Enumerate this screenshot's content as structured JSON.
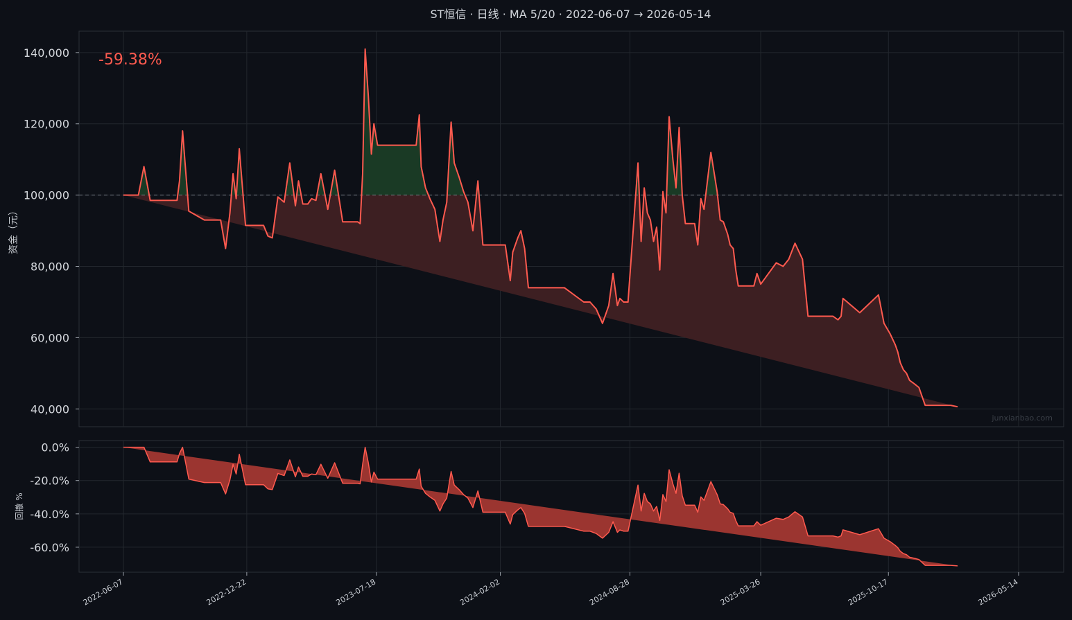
{
  "chart_data": [
    {
      "type": "area",
      "panel": "equity",
      "title": "ST恒信 · 日线 · MA 5/20 · 2022-06-07 → 2026-05-14",
      "ylabel": "资金（元）",
      "xlabel": "",
      "annotation": "-59.38%",
      "watermark": "junxianbao.com",
      "baseline": 100000,
      "ylim": [
        35000,
        146000
      ],
      "yticks": [
        40000,
        60000,
        80000,
        100000,
        120000,
        140000
      ],
      "ytick_labels": [
        "40,000",
        "60,000",
        "80,000",
        "100,000",
        "120,000",
        "140,000"
      ],
      "xticks": [
        "2022-06-07",
        "2022-12-22",
        "2023-07-18",
        "2024-02-02",
        "2024-08-28",
        "2025-03-26",
        "2025-10-17",
        "2026-05-14"
      ],
      "grid": true,
      "colors": {
        "line": "#ff5a4f",
        "gain_fill": "#1a3a25",
        "loss_fill": "#3d1f22",
        "baseline": "#7a8088"
      },
      "x": [
        "2022-06-07",
        "2022-07-01",
        "2022-07-10",
        "2022-07-20",
        "2022-08-01",
        "2022-08-20",
        "2022-09-01",
        "2022-09-05",
        "2022-09-10",
        "2022-09-14",
        "2022-09-20",
        "2022-10-15",
        "2022-10-25",
        "2022-10-28",
        "2022-11-05",
        "2022-11-10",
        "2022-11-18",
        "2022-11-25",
        "2022-11-30",
        "2022-12-05",
        "2022-12-10",
        "2022-12-20",
        "2022-12-28",
        "2023-01-01",
        "2023-01-05",
        "2023-01-12",
        "2023-01-18",
        "2023-01-25",
        "2023-02-01",
        "2023-02-10",
        "2023-02-20",
        "2023-03-01",
        "2023-03-10",
        "2023-03-15",
        "2023-03-22",
        "2023-03-30",
        "2023-04-05",
        "2023-04-12",
        "2023-04-20",
        "2023-05-01",
        "2023-05-12",
        "2023-05-25",
        "2023-06-05",
        "2023-06-10",
        "2023-06-14",
        "2023-06-18",
        "2023-06-22",
        "2023-06-26",
        "2023-06-30",
        "2023-07-05",
        "2023-07-10",
        "2023-07-14",
        "2023-07-20",
        "2023-08-10",
        "2023-09-01",
        "2023-09-20",
        "2023-09-25",
        "2023-09-28",
        "2023-10-05",
        "2023-10-12",
        "2023-10-20",
        "2023-10-28",
        "2023-11-02",
        "2023-11-08",
        "2023-11-15",
        "2023-11-20",
        "2023-11-28",
        "2023-12-05",
        "2023-12-12",
        "2023-12-20",
        "2023-12-28",
        "2024-01-05",
        "2024-01-10",
        "2024-01-25",
        "2024-02-10",
        "2024-02-18",
        "2024-02-22",
        "2024-03-01",
        "2024-03-06",
        "2024-03-12",
        "2024-03-18",
        "2024-03-25",
        "2024-04-01",
        "2024-04-15",
        "2024-05-15",
        "2024-06-15",
        "2024-06-20",
        "2024-06-25",
        "2024-07-05",
        "2024-07-15",
        "2024-07-25",
        "2024-08-01",
        "2024-08-08",
        "2024-08-12",
        "2024-08-18",
        "2024-08-25",
        "2024-09-01",
        "2024-09-10",
        "2024-09-15",
        "2024-09-20",
        "2024-09-25",
        "2024-09-30",
        "2024-10-05",
        "2024-10-10",
        "2024-10-15",
        "2024-10-20",
        "2024-10-25",
        "2024-10-30",
        "2024-11-05",
        "2024-11-10",
        "2024-11-15",
        "2024-11-20",
        "2024-11-25",
        "2024-11-28",
        "2024-12-01",
        "2024-12-05",
        "2024-12-10",
        "2024-12-15",
        "2024-12-20",
        "2024-12-25",
        "2025-01-05",
        "2025-01-15",
        "2025-01-20",
        "2025-01-25",
        "2025-02-01",
        "2025-02-05",
        "2025-02-10",
        "2025-02-14",
        "2025-02-18",
        "2025-02-22",
        "2025-03-01",
        "2025-03-05",
        "2025-03-10",
        "2025-03-15",
        "2025-03-20",
        "2025-03-26",
        "2025-04-20",
        "2025-05-01",
        "2025-05-10",
        "2025-05-20",
        "2025-06-01",
        "2025-06-10",
        "2025-06-20",
        "2025-07-01",
        "2025-07-10",
        "2025-07-20",
        "2025-07-28",
        "2025-08-02",
        "2025-08-05",
        "2025-09-01",
        "2025-10-01",
        "2025-10-10",
        "2025-10-20",
        "2025-10-28",
        "2025-11-01",
        "2025-11-05",
        "2025-11-10",
        "2025-11-15",
        "2025-11-20",
        "2025-11-28",
        "2025-12-05",
        "2025-12-15",
        "2025-12-25",
        "2026-01-05",
        "2026-01-15",
        "2026-01-25",
        "2026-02-05",
        "2026-02-20",
        "2026-03-05",
        "2026-04-01",
        "2026-04-20",
        "2026-05-01",
        "2026-05-08",
        "2026-05-14"
      ],
      "series": [
        {
          "values": [
            100000,
            100000,
            108000,
            98500,
            98500,
            98500,
            98500,
            104000,
            118000,
            109000,
            95500,
            93000,
            93000,
            93000,
            93000,
            93000,
            85000,
            95000,
            106000,
            99000,
            113000,
            91500,
            91500,
            91500,
            91500,
            91500,
            91500,
            88500,
            88000,
            99500,
            98000,
            109000,
            97000,
            104000,
            97500,
            97500,
            99000,
            98500,
            106000,
            96000,
            107000,
            92500,
            92500,
            92500,
            92500,
            92500,
            92000,
            106000,
            141000,
            128000,
            111500,
            120000,
            114000,
            114000,
            114000,
            114000,
            122500,
            108000,
            102000,
            99000,
            96000,
            87000,
            93000,
            98000,
            120500,
            109000,
            105000,
            101000,
            98000,
            90000,
            104000,
            86000,
            86000,
            86000,
            86000,
            76000,
            84000,
            88000,
            90000,
            85000,
            74000,
            74000,
            74000,
            74000,
            74000,
            70000,
            70000,
            70000,
            68000,
            64000,
            69000,
            78000,
            69000,
            71000,
            70000,
            70000,
            87000,
            109000,
            87000,
            102000,
            95000,
            93000,
            87000,
            91000,
            79000,
            101000,
            95000,
            122000,
            110000,
            102000,
            119000,
            100000,
            92000,
            92000,
            92000,
            92000,
            92000,
            86000,
            99000,
            96000,
            112000,
            101000,
            93000,
            92500,
            89000,
            86000,
            85000,
            79000,
            74500,
            74500,
            74500,
            74500,
            74500,
            74500,
            78000,
            75000,
            81000,
            80000,
            82000,
            86500,
            82000,
            66000,
            66000,
            66000,
            66000,
            66000,
            65000,
            66000,
            71000,
            67000,
            72000,
            64000,
            61000,
            58000,
            56000,
            53000,
            51000,
            50000,
            48000,
            47000,
            46000,
            41000,
            41000,
            41000,
            41000,
            41000,
            40600
          ]
        }
      ]
    },
    {
      "type": "area",
      "panel": "drawdown",
      "ylabel": "回撤 %",
      "ylim": [
        -75,
        4
      ],
      "yticks": [
        0,
        -20,
        -40,
        -60
      ],
      "ytick_labels": [
        "0.0%",
        "-20.0%",
        "-40.0%",
        "-60.0%"
      ],
      "xticks": [
        "2022-06-07",
        "2022-12-22",
        "2023-07-18",
        "2024-02-02",
        "2024-08-28",
        "2025-03-26",
        "2025-10-17",
        "2026-05-14"
      ],
      "grid": true,
      "colors": {
        "line": "#ff5a4f",
        "fill": "#9b3530"
      },
      "x": [
        "2022-06-07",
        "2022-07-01",
        "2022-07-10",
        "2022-07-20",
        "2022-08-01",
        "2022-08-20",
        "2022-09-01",
        "2022-09-05",
        "2022-09-10",
        "2022-09-14",
        "2022-09-20",
        "2022-10-15",
        "2022-10-25",
        "2022-10-28",
        "2022-11-05",
        "2022-11-10",
        "2022-11-18",
        "2022-11-25",
        "2022-11-30",
        "2022-12-05",
        "2022-12-10",
        "2022-12-20",
        "2022-12-28",
        "2023-01-01",
        "2023-01-05",
        "2023-01-12",
        "2023-01-18",
        "2023-01-25",
        "2023-02-01",
        "2023-02-10",
        "2023-02-20",
        "2023-03-01",
        "2023-03-10",
        "2023-03-15",
        "2023-03-22",
        "2023-03-30",
        "2023-04-05",
        "2023-04-12",
        "2023-04-20",
        "2023-05-01",
        "2023-05-12",
        "2023-05-25",
        "2023-06-05",
        "2023-06-10",
        "2023-06-14",
        "2023-06-18",
        "2023-06-22",
        "2023-06-26",
        "2023-06-30",
        "2023-07-05",
        "2023-07-10",
        "2023-07-14",
        "2023-07-20",
        "2023-08-10",
        "2023-09-01",
        "2023-09-20",
        "2023-09-25",
        "2023-09-28",
        "2023-10-05",
        "2023-10-12",
        "2023-10-20",
        "2023-10-28",
        "2023-11-02",
        "2023-11-08",
        "2023-11-15",
        "2023-11-20",
        "2023-11-28",
        "2023-12-05",
        "2023-12-12",
        "2023-12-20",
        "2023-12-28",
        "2024-01-05",
        "2024-01-10",
        "2024-01-25",
        "2024-02-10",
        "2024-02-18",
        "2024-02-22",
        "2024-03-01",
        "2024-03-06",
        "2024-03-12",
        "2024-03-18",
        "2024-03-25",
        "2024-04-01",
        "2024-04-15",
        "2024-05-15",
        "2024-06-15",
        "2024-06-20",
        "2024-06-25",
        "2024-07-05",
        "2024-07-15",
        "2024-07-25",
        "2024-08-01",
        "2024-08-08",
        "2024-08-12",
        "2024-08-18",
        "2024-08-25",
        "2024-09-01",
        "2024-09-10",
        "2024-09-15",
        "2024-09-20",
        "2024-09-25",
        "2024-09-30",
        "2024-10-05",
        "2024-10-10",
        "2024-10-15",
        "2024-10-20",
        "2024-10-25",
        "2024-10-30",
        "2024-11-05",
        "2024-11-10",
        "2024-11-15",
        "2024-11-20",
        "2024-11-25",
        "2024-11-28",
        "2024-12-01",
        "2024-12-05",
        "2024-12-10",
        "2024-12-15",
        "2024-12-20",
        "2024-12-25",
        "2025-01-05",
        "2025-01-15",
        "2025-01-20",
        "2025-01-25",
        "2025-02-01",
        "2025-02-05",
        "2025-02-10",
        "2025-02-14",
        "2025-02-18",
        "2025-02-22",
        "2025-03-01",
        "2025-03-05",
        "2025-03-10",
        "2025-03-15",
        "2025-03-20",
        "2025-03-26",
        "2025-04-20",
        "2025-05-01",
        "2025-05-10",
        "2025-05-20",
        "2025-06-01",
        "2025-06-10",
        "2025-06-20",
        "2025-07-01",
        "2025-07-10",
        "2025-07-20",
        "2025-07-28",
        "2025-08-02",
        "2025-08-05",
        "2025-09-01",
        "2025-10-01",
        "2025-10-10",
        "2025-10-20",
        "2025-10-28",
        "2025-11-01",
        "2025-11-05",
        "2025-11-10",
        "2025-11-15",
        "2025-11-20",
        "2025-11-28",
        "2025-12-05",
        "2025-12-15",
        "2025-12-25",
        "2026-01-05",
        "2026-01-15",
        "2026-01-25",
        "2026-02-05",
        "2026-02-20",
        "2026-03-05",
        "2026-04-01",
        "2026-04-20",
        "2026-05-01",
        "2026-05-08",
        "2026-05-14"
      ],
      "series": [
        {
          "values": [
            0,
            0,
            0,
            -8.8,
            -8.8,
            -8.8,
            -8.8,
            -3.7,
            0,
            -7.6,
            -19.1,
            -21.2,
            -21.2,
            -21.2,
            -21.2,
            -21.2,
            -28,
            -19.5,
            -10.2,
            -16.1,
            -4.2,
            -22.5,
            -22.5,
            -22.5,
            -22.5,
            -22.5,
            -22.5,
            -25,
            -25.4,
            -15.7,
            -17,
            -7.6,
            -17.8,
            -11.9,
            -17.4,
            -17.4,
            -16.1,
            -16.5,
            -10.2,
            -18.6,
            -9.3,
            -21.6,
            -21.6,
            -21.6,
            -21.6,
            -21.6,
            -22,
            -10.2,
            0,
            -9.2,
            -20.9,
            -14.9,
            -19.1,
            -19.1,
            -19.1,
            -19.1,
            -13.1,
            -23.4,
            -27.7,
            -29.8,
            -31.9,
            -38.3,
            -34,
            -30.5,
            -14.5,
            -22.7,
            -25.5,
            -28.4,
            -30.5,
            -36.2,
            -26.2,
            -39,
            -39,
            -39,
            -39,
            -46.1,
            -40.4,
            -37.6,
            -36.2,
            -39.7,
            -47.5,
            -47.5,
            -47.5,
            -47.5,
            -47.5,
            -50.4,
            -50.4,
            -50.4,
            -51.8,
            -54.6,
            -51.1,
            -44.7,
            -51.1,
            -49.6,
            -50.4,
            -50.4,
            -38.3,
            -22.7,
            -38.3,
            -27.7,
            -32.6,
            -34,
            -38.3,
            -35.5,
            -44,
            -28.4,
            -32.6,
            -13.5,
            -22,
            -27.7,
            -15.6,
            -29.1,
            -34.8,
            -34.8,
            -34.8,
            -34.8,
            -34.8,
            -39,
            -29.8,
            -31.9,
            -20.6,
            -28.4,
            -34,
            -34.4,
            -36.9,
            -39,
            -39.7,
            -44,
            -47.2,
            -47.2,
            -47.2,
            -47.2,
            -47.2,
            -47.2,
            -44.7,
            -46.8,
            -42.6,
            -43.3,
            -41.8,
            -38.7,
            -41.8,
            -53.2,
            -53.2,
            -53.2,
            -53.2,
            -53.2,
            -53.9,
            -53.2,
            -49.6,
            -52.5,
            -48.9,
            -54.6,
            -56.7,
            -58.9,
            -60.3,
            -62.4,
            -63.8,
            -64.5,
            -66,
            -66.7,
            -67.4,
            -70.9,
            -70.9,
            -70.9,
            -70.9,
            -70.9,
            -71.2
          ]
        }
      ]
    }
  ]
}
